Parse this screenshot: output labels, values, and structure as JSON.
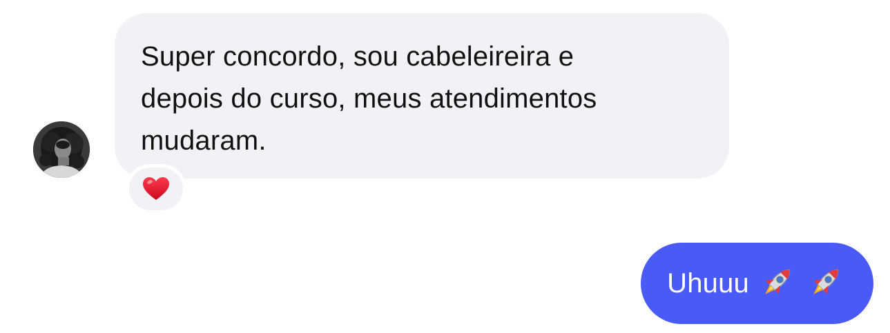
{
  "messages": {
    "incoming": {
      "text": "Super concordo, sou cabeleireira e\ndepois do curso, meus atendimentos\nmudaram.",
      "reaction_icon": "red-heart",
      "avatar": "profile-photo"
    },
    "outgoing": {
      "text": "Uhuuu",
      "emoji_icons": [
        "rocket",
        "rocket"
      ]
    }
  },
  "colors": {
    "incoming_bubble": "#f1f2f5",
    "outgoing_bubble": "#4a5af7",
    "heart": "#e0102a"
  }
}
